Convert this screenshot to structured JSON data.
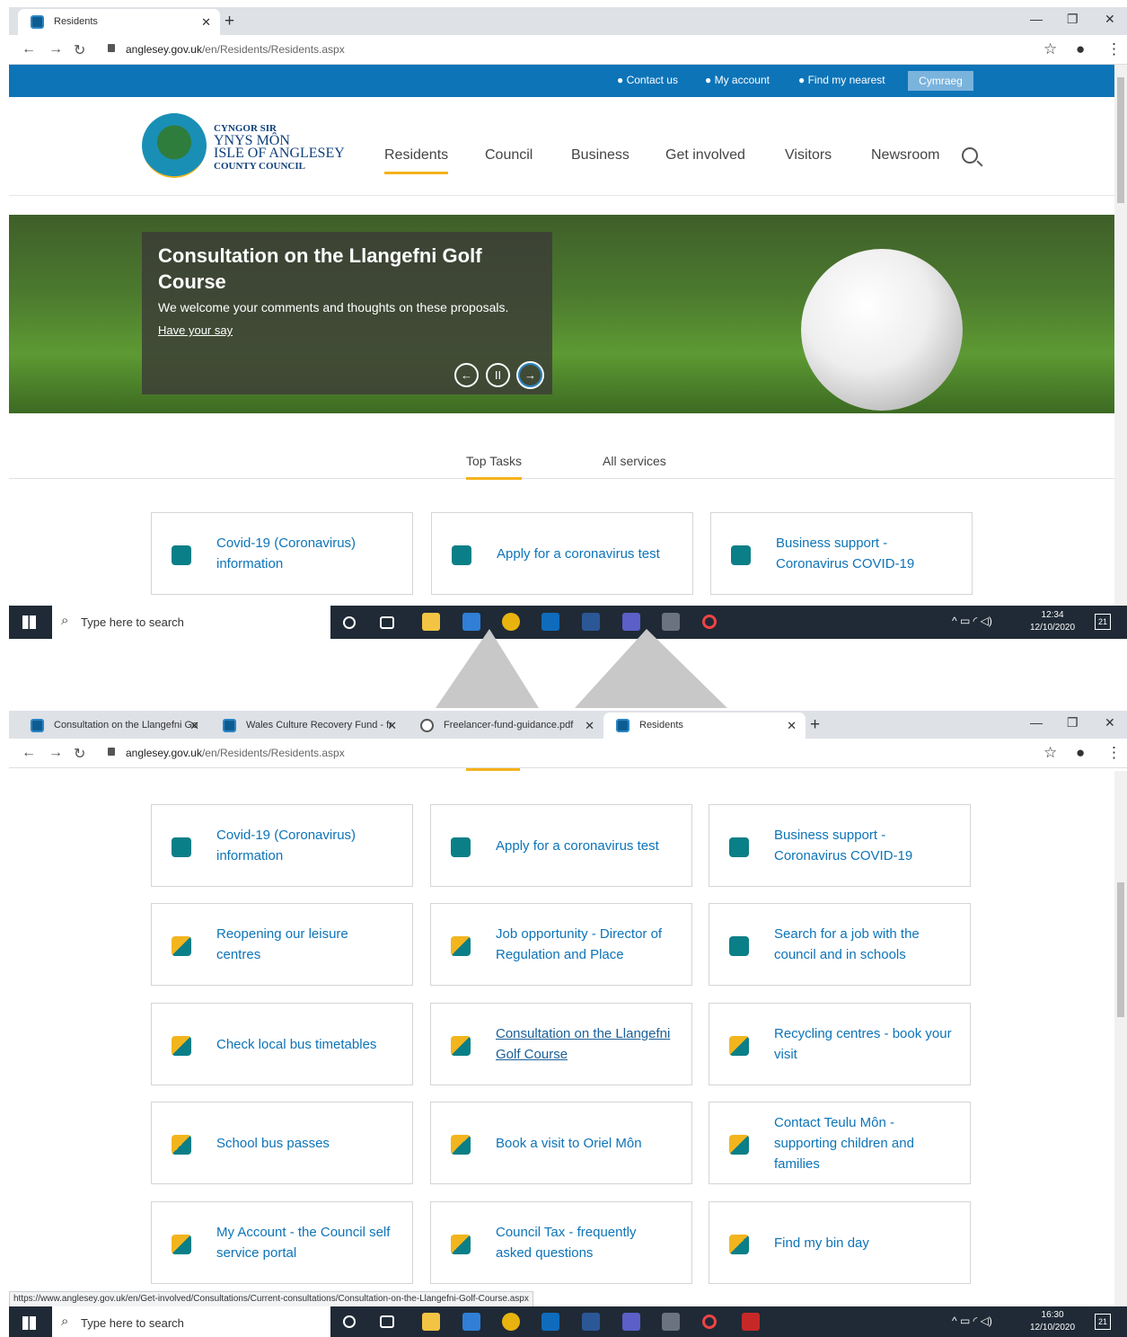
{
  "shot1": {
    "tabs": [
      {
        "label": "Residents"
      }
    ],
    "url": {
      "domain": "anglesey.gov.uk",
      "path": "/en/Residents/Residents.aspx"
    },
    "topbar": {
      "contact": "Contact us",
      "account": "My account",
      "nearest": "Find my nearest",
      "lang": "Cymraeg"
    },
    "logo": {
      "l1": "CYNGOR SIR",
      "l2": "YNYS MÔN",
      "l3": "ISLE OF ANGLESEY",
      "l4": "COUNTY COUNCIL"
    },
    "nav": [
      "Residents",
      "Council",
      "Business",
      "Get involved",
      "Visitors",
      "Newsroom"
    ],
    "hero": {
      "title": "Consultation on the Llangefni Golf Course",
      "subtitle": "We welcome your comments and thoughts on these proposals.",
      "link": "Have your say"
    },
    "toptabs": [
      "Top Tasks",
      "All services"
    ],
    "cards": [
      "Covid-19 (Coronavirus) information",
      "Apply for a coronavirus test",
      "Business support - Coronavirus COVID-19"
    ],
    "taskbar": {
      "search": "Type here to search",
      "time": "12:34",
      "date": "12/10/2020",
      "notif": "21"
    }
  },
  "shot2": {
    "tabs": [
      {
        "label": "Consultation on the Llangefni Go"
      },
      {
        "label": "Wales Culture Recovery Fund - fr"
      },
      {
        "label": "Freelancer-fund-guidance.pdf"
      },
      {
        "label": "Residents"
      }
    ],
    "url": {
      "domain": "anglesey.gov.uk",
      "path": "/en/Residents/Residents.aspx"
    },
    "cards": [
      "Covid-19 (Coronavirus) information",
      "Apply for a coronavirus test",
      "Business support - Coronavirus COVID-19",
      "Reopening our leisure centres",
      "Job opportunity - Director of Regulation and Place",
      "Search for a job with the council and in schools",
      "Check local bus timetables",
      "Consultation on the Llangefni Golf Course",
      "Recycling centres - book your visit",
      "School bus passes",
      "Book a visit to Oriel Môn",
      "Contact Teulu Môn - supporting children and families",
      "My Account - the Council self service portal",
      "Council Tax - frequently asked questions",
      "Find my bin day"
    ],
    "status_url": "https://www.anglesey.gov.uk/en/Get-involved/Consultations/Current-consultations/Consultation-on-the-Llangefni-Golf-Course.aspx",
    "taskbar": {
      "search": "Type here to search",
      "time": "16:30",
      "date": "12/10/2020",
      "notif": "21"
    }
  },
  "colors": {
    "brand_blue": "#0d74b8",
    "accent_yellow": "#f5b21b",
    "icon_teal": "#0b7f87"
  }
}
